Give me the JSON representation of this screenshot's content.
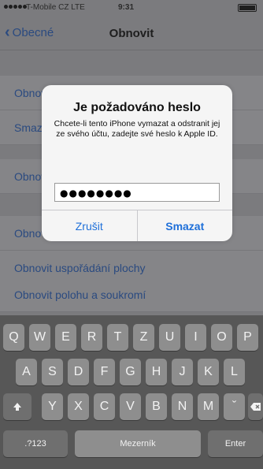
{
  "status_bar": {
    "carrier": "T-Mobile CZ  LTE",
    "time": "9:31"
  },
  "nav": {
    "back_label": "Obecné",
    "title": "Obnovit"
  },
  "rows": [
    {
      "label": "Obnovit všechna nastavení"
    },
    {
      "label": "Smazat data a nastavení"
    },
    {
      "label": "Obnovit síťová nastavení"
    },
    {
      "label": "Obnovit slovník klávesnice"
    },
    {
      "label": "Obnovit uspořádání plochy"
    },
    {
      "label": "Obnovit polohu a soukromí"
    }
  ],
  "alert": {
    "title": "Je požadováno heslo",
    "message": "Chcete-li tento iPhone vymazat a odstranit jej ze svého účtu, zadejte své heslo k Apple ID.",
    "password_value": "●●●●●●●●",
    "cancel_label": "Zrušit",
    "confirm_label": "Smazat"
  },
  "keyboard": {
    "row1": [
      "Q",
      "W",
      "E",
      "R",
      "T",
      "Z",
      "U",
      "I",
      "O",
      "P"
    ],
    "row2": [
      "A",
      "S",
      "D",
      "F",
      "G",
      "H",
      "J",
      "K",
      "L"
    ],
    "row3": [
      "Y",
      "X",
      "C",
      "V",
      "B",
      "N",
      "M"
    ],
    "shift_icon": "shift-icon",
    "accent_key": "ˇ",
    "delete_icon": "backspace-icon",
    "numbers_label": ".?123",
    "space_label": "Mezerník",
    "enter_label": "Enter"
  },
  "colors": {
    "accent": "#1e6fd9",
    "link_dimmed": "#2a4a80"
  }
}
